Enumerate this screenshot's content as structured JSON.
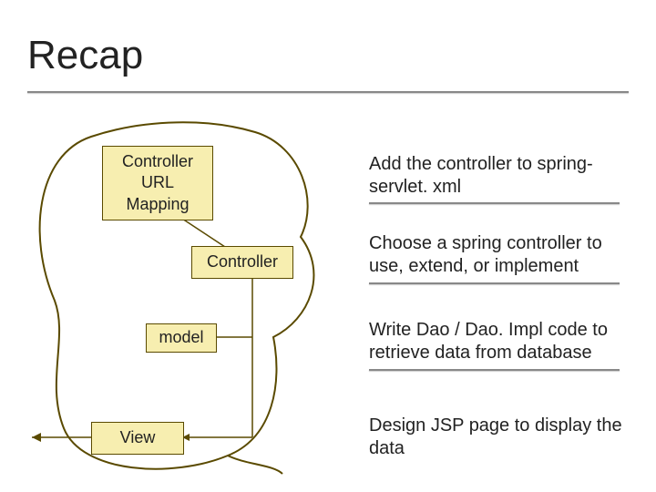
{
  "title": "Recap",
  "boxes": {
    "url_mapping": "Controller\nURL\nMapping",
    "controller": "Controller",
    "model": "model",
    "view": "View"
  },
  "annotations": {
    "a1": "Add the controller to spring-servlet. xml",
    "a2": "Choose a spring controller to use, extend, or implement",
    "a3": "Write Dao / Dao. Impl code to retrieve data from database",
    "a4": "Design JSP page to display the data"
  }
}
